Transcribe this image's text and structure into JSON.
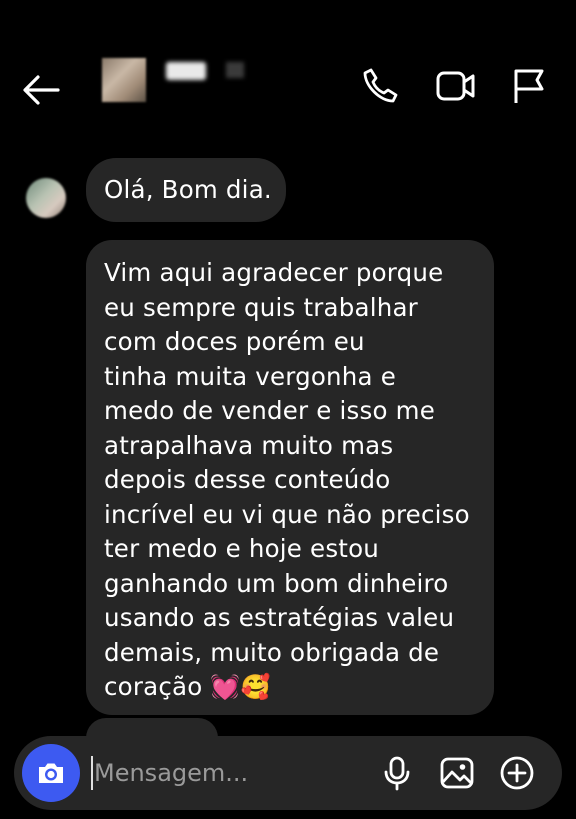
{
  "header": {
    "back_icon": "arrow-left-icon",
    "actions": [
      "phone-icon",
      "video-camera-icon",
      "flag-icon"
    ]
  },
  "messages": [
    {
      "text": "Olá, Bom dia."
    },
    {
      "lines": [
        "Vim aqui agradecer porque",
        "eu sempre quis trabalhar",
        "com doces porém eu",
        "tinha muita vergonha e",
        "medo de vender e isso me",
        "atrapalhava muito mas",
        "depois desse conteúdo",
        "incrível eu vi que não preciso",
        "ter medo e hoje estou",
        "ganhando um bom dinheiro",
        "usando as estratégias valeu",
        "demais, muito obrigada de",
        "coração"
      ],
      "emojis": "💓🥰"
    }
  ],
  "composer": {
    "placeholder": "Mensagem...",
    "value": "",
    "accent": "#3d5af1"
  }
}
